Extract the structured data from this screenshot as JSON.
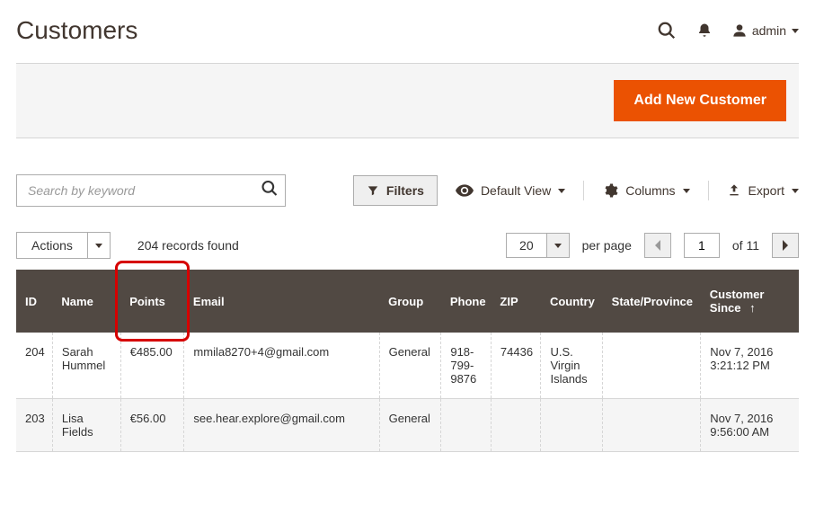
{
  "header": {
    "title": "Customers",
    "user_label": "admin"
  },
  "strip": {
    "add_button": "Add New Customer"
  },
  "toolbar": {
    "search_placeholder": "Search by keyword",
    "filters_label": "Filters",
    "default_view_label": "Default View",
    "columns_label": "Columns",
    "export_label": "Export"
  },
  "listing": {
    "actions_label": "Actions",
    "records_found": "204 records found",
    "page_size": "20",
    "per_page_label": "per page",
    "current_page": "1",
    "of_label": "of 11"
  },
  "table": {
    "columns": {
      "id": "ID",
      "name": "Name",
      "points": "Points",
      "email": "Email",
      "group": "Group",
      "phone": "Phone",
      "zip": "ZIP",
      "country": "Country",
      "state": "State/Province",
      "since": "Customer Since"
    },
    "rows": [
      {
        "id": "204",
        "name": "Sarah Hummel",
        "points": "€485.00",
        "email": "mmila8270+4@gmail.com",
        "group": "General",
        "phone": "918-799-9876",
        "zip": "74436",
        "country": "U.S. Virgin Islands",
        "state": "",
        "since": "Nov 7, 2016 3:21:12 PM"
      },
      {
        "id": "203",
        "name": "Lisa Fields",
        "points": "€56.00",
        "email": "see.hear.explore@gmail.com",
        "group": "General",
        "phone": "",
        "zip": "",
        "country": "",
        "state": "",
        "since": "Nov 7, 2016 9:56:00 AM"
      }
    ]
  }
}
